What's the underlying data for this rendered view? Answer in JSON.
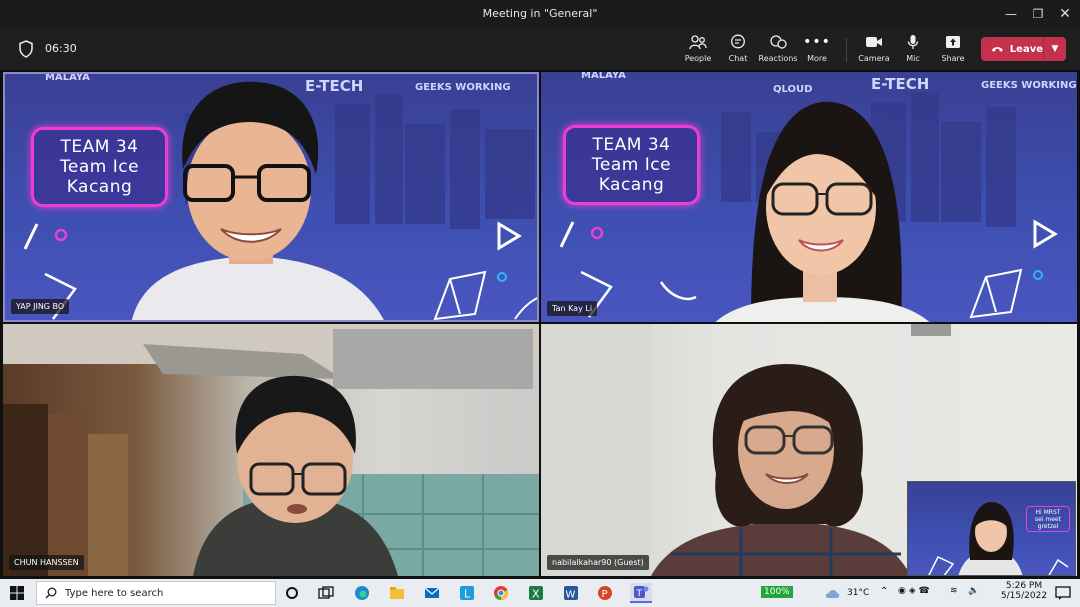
{
  "window": {
    "title": "Meeting in \"General\""
  },
  "meeting": {
    "duration": "06:30"
  },
  "toolbar": {
    "people": "People",
    "chat": "Chat",
    "reactions": "Reactions",
    "more": "More",
    "camera": "Camera",
    "mic": "Mic",
    "share": "Share",
    "leave": "Leave"
  },
  "participants": [
    {
      "name": "YAP JING BO"
    },
    {
      "name": "Tan Kay Li"
    },
    {
      "name": "CHUN HANSSEN"
    },
    {
      "name": "nabilalkahar90 (Guest)"
    }
  ],
  "background": {
    "team_line1": "TEAM 34",
    "team_line2": "Team Ice",
    "team_line3": "Kacang",
    "brand_etech": "E-TECH",
    "brand_geeks": "GEEKS WORKING",
    "brand_malaya": "MALAYA",
    "brand_qloud": "QLOUD"
  },
  "self_view": {
    "line1": "Hi MRST",
    "line2": "sei meet",
    "line3": "gretzel"
  },
  "taskbar": {
    "search_placeholder": "Type here to search",
    "battery": "100%",
    "temperature": "31°C",
    "time": "5:26 PM",
    "date": "5/15/2022"
  },
  "colors": {
    "leave": "#c4314b",
    "team_border": "#e93fd6",
    "bg_purple": "#3d4fb0"
  }
}
